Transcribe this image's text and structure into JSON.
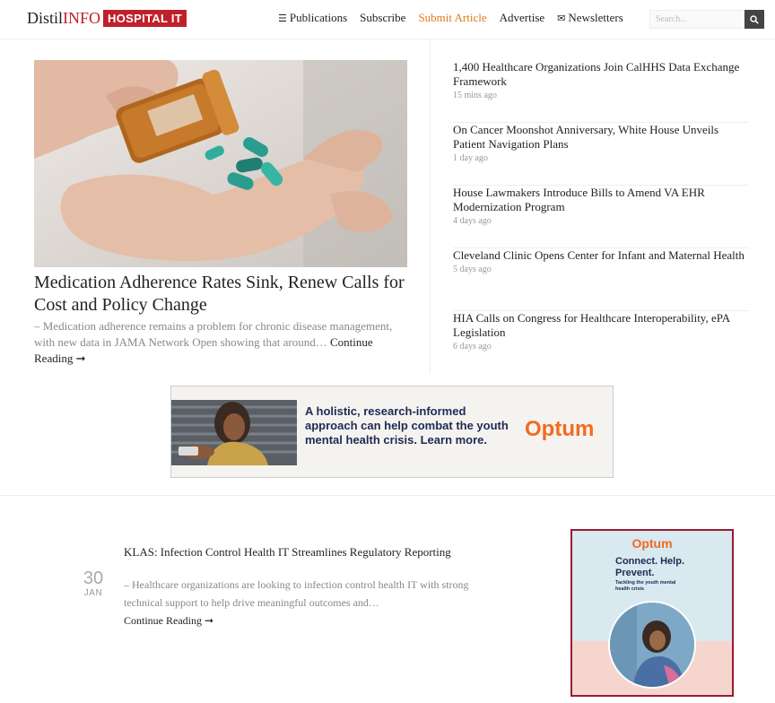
{
  "header": {
    "logo_distil": "Distil",
    "logo_info": "INFO",
    "logo_badge": "HOSPITAL IT",
    "nav": [
      {
        "label": "Publications",
        "icon": "menu-icon"
      },
      {
        "label": "Subscribe"
      },
      {
        "label": "Submit Article"
      },
      {
        "label": "Advertise"
      },
      {
        "label": "Newsletters",
        "icon": "envelope-icon"
      }
    ],
    "search_placeholder": "Search...",
    "accent_color": "#c0202a",
    "highlight_color": "#e07b18"
  },
  "feature": {
    "title": "Medication Adherence Rates Sink, Renew Calls for Cost and Policy Change",
    "excerpt": "– Medication adherence remains a problem for chronic disease management, with new data in JAMA Network Open showing that around…",
    "more": "Continue Reading ➞"
  },
  "side_list": [
    {
      "title": "1,400 Healthcare Organizations Join CalHHS Data Exchange Framework",
      "time": "15 mins ago"
    },
    {
      "title": "On Cancer Moonshot Anniversary, White House Unveils Patient Navigation Plans",
      "time": "1 day ago"
    },
    {
      "title": "House Lawmakers Introduce Bills to Amend VA EHR Modernization Program",
      "time": "4 days ago"
    },
    {
      "title": "Cleveland Clinic Opens Center for Infant and Maternal Health",
      "time": "5 days ago"
    },
    {
      "title": "HIA Calls on Congress for Healthcare Interoperability, ePA Legislation",
      "time": "6 days ago"
    }
  ],
  "banner_ad": {
    "text": "A holistic, research-informed approach can help combat the youth mental health crisis. Learn more.",
    "brand": "Optum"
  },
  "post": {
    "day": "30",
    "month": "JAN",
    "title": "KLAS: Infection Control Health IT Streamlines Regulatory Reporting",
    "excerpt": "– Healthcare organizations are looking to infection control health IT with strong technical support to help drive meaningful outcomes and…",
    "more": "Continue Reading ➞"
  },
  "side_ad": {
    "brand": "Optum",
    "tagline_1": "Connect. Help.",
    "tagline_2": "Prevent.",
    "sub": "Tackling the youth mental health crisis"
  }
}
